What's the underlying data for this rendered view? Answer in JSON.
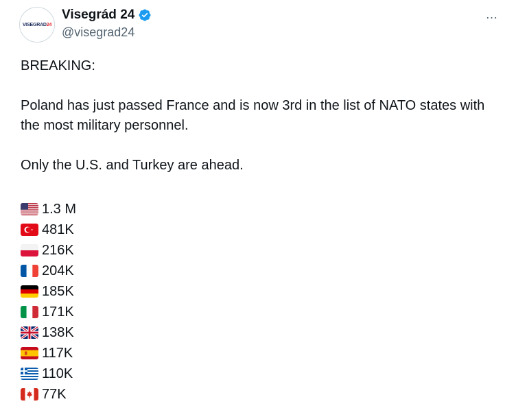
{
  "tweet": {
    "author": {
      "display_name": "Visegrád 24",
      "handle": "@visegrad24",
      "avatar_text": "VISEGRAD",
      "avatar_number": "24",
      "verified": true
    },
    "more_icon": "…",
    "paragraphs": [
      "BREAKING:",
      "Poland has just passed France and is now 3rd in the list of NATO states with the most military personnel.",
      "Only the U.S. and Turkey are ahead."
    ],
    "stats": [
      {
        "country": "us",
        "value": "1.3 M"
      },
      {
        "country": "tr",
        "value": "481K"
      },
      {
        "country": "pl",
        "value": "216K"
      },
      {
        "country": "fr",
        "value": "204K"
      },
      {
        "country": "de",
        "value": "185K"
      },
      {
        "country": "it",
        "value": "171K"
      },
      {
        "country": "gb",
        "value": "138K"
      },
      {
        "country": "es",
        "value": "117K"
      },
      {
        "country": "gr",
        "value": "110K"
      },
      {
        "country": "ca",
        "value": "77K"
      }
    ]
  },
  "colors": {
    "verified": "#1d9bf0",
    "secondary_text": "#536471",
    "text": "#0f1419"
  }
}
